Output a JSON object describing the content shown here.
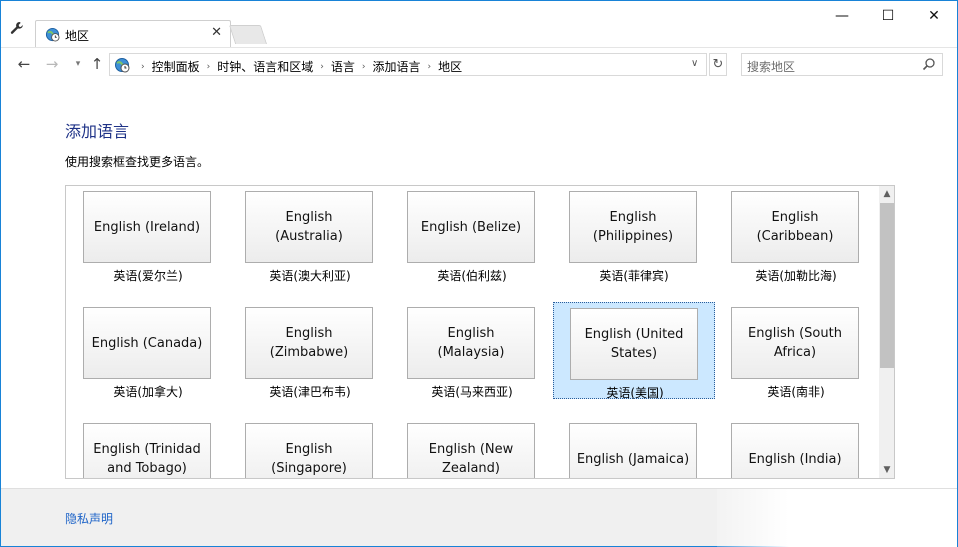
{
  "titlebar": {
    "tab_title": "地区",
    "close_glyph": "✕",
    "minimize_glyph": "—",
    "maximize_glyph": "☐",
    "window_close_glyph": "✕"
  },
  "navbar": {
    "back_glyph": "←",
    "forward_glyph": "→",
    "recent_glyph": "▾",
    "up_glyph": "↑",
    "breadcrumbs": [
      "控制面板",
      "时钟、语言和区域",
      "语言",
      "添加语言",
      "地区"
    ],
    "dropdown_glyph": "∨",
    "refresh_glyph": "↻",
    "search_placeholder": "搜索地区"
  },
  "main": {
    "heading": "添加语言",
    "instruction": "使用搜索框查找更多语言。",
    "languages": [
      {
        "name": "English (Ireland)",
        "label": "英语(爱尔兰)",
        "selected": false
      },
      {
        "name": "English (Australia)",
        "label": "英语(澳大利亚)",
        "selected": false
      },
      {
        "name": "English (Belize)",
        "label": "英语(伯利兹)",
        "selected": false
      },
      {
        "name": "English (Philippines)",
        "label": "英语(菲律宾)",
        "selected": false
      },
      {
        "name": "English (Caribbean)",
        "label": "英语(加勒比海)",
        "selected": false
      },
      {
        "name": "English (Canada)",
        "label": "英语(加拿大)",
        "selected": false
      },
      {
        "name": "English (Zimbabwe)",
        "label": "英语(津巴布韦)",
        "selected": false
      },
      {
        "name": "English (Malaysia)",
        "label": "英语(马来西亚)",
        "selected": false
      },
      {
        "name": "English (United States)",
        "label": "英语(美国)",
        "selected": true
      },
      {
        "name": "English (South Africa)",
        "label": "英语(南非)",
        "selected": false
      },
      {
        "name": "English (Trinidad and Tobago)",
        "label": "",
        "selected": false
      },
      {
        "name": "English (Singapore)",
        "label": "",
        "selected": false
      },
      {
        "name": "English (New Zealand)",
        "label": "",
        "selected": false
      },
      {
        "name": "English (Jamaica)",
        "label": "",
        "selected": false
      },
      {
        "name": "English (India)",
        "label": "",
        "selected": false
      }
    ],
    "scroll_up_glyph": "▲",
    "scroll_down_glyph": "▼"
  },
  "footer": {
    "privacy_link": "隐私声明"
  },
  "colors": {
    "accent_border": "#1883d7",
    "heading": "#1e3287",
    "link": "#1e64c8",
    "selection": "#cce8ff"
  },
  "icons": {
    "settings": "wrench-icon",
    "tab": "globe-clock-icon",
    "address": "globe-clock-icon",
    "search": "magnifier-icon"
  }
}
